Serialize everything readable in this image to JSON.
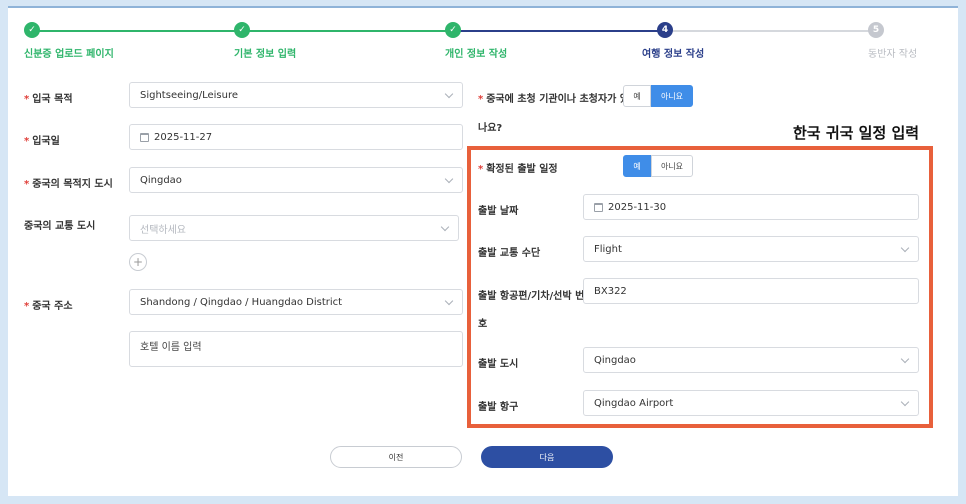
{
  "stepper": {
    "steps": [
      {
        "label": "신분증 업로드 페이지",
        "state": "done",
        "mark": "✓"
      },
      {
        "label": "기본 정보 입력",
        "state": "done",
        "mark": "✓"
      },
      {
        "label": "개인 정보 작성",
        "state": "done",
        "mark": "✓"
      },
      {
        "label": "여행 정보 작성",
        "state": "current",
        "mark": "4"
      },
      {
        "label": "동반자 작성",
        "state": "todo",
        "mark": "5"
      }
    ]
  },
  "left": {
    "purpose_label": "입국 목적",
    "purpose_value": "Sightseeing/Leisure",
    "entry_date_label": "입국일",
    "entry_date_value": "2025-11-27",
    "dest_city_label": "중국의 목적지 도시",
    "dest_city_value": "Qingdao",
    "transit_city_label": "중국의 교통 도시",
    "transit_city_placeholder": "선택하세요",
    "add_symbol": "+",
    "address_label": "중국 주소",
    "address_value": "Shandong / Qingdao / Huangdao District",
    "hotel_placeholder": "호텔 이름 입력"
  },
  "right": {
    "invite_label_line1": "중국에 초청 기관이나 초청자가 있",
    "invite_label_line2": "나요?",
    "invite_yes": "예",
    "invite_no": "아니요",
    "invite_selected": "아니요",
    "overlay_title": "한국 귀국 일정 입력",
    "confirmed_label": "확정된 출발 일정",
    "confirmed_yes": "예",
    "confirmed_no": "아니요",
    "confirmed_selected": "예",
    "dep_date_label": "출발 날짜",
    "dep_date_value": "2025-11-30",
    "dep_transport_label": "출발 교통 수단",
    "dep_transport_value": "Flight",
    "flight_no_label_line1": "출발 항공편/기차/선박 번",
    "flight_no_label_line2": "호",
    "flight_no_value": "BX322",
    "dep_city_label": "출발 도시",
    "dep_city_value": "Qingdao",
    "dep_port_label": "출발 항구",
    "dep_port_value": "Qingdao Airport"
  },
  "footer": {
    "prev_label": "이전",
    "next_label": "다음"
  },
  "colors": {
    "done": "#2fb56b",
    "current": "#2b3f8a",
    "todo": "#c5c8cf",
    "toggle_on": "#3f8de8",
    "highlight_box": "#e8603b",
    "next_button": "#2d4fa3",
    "background": "#d6e6f5"
  }
}
